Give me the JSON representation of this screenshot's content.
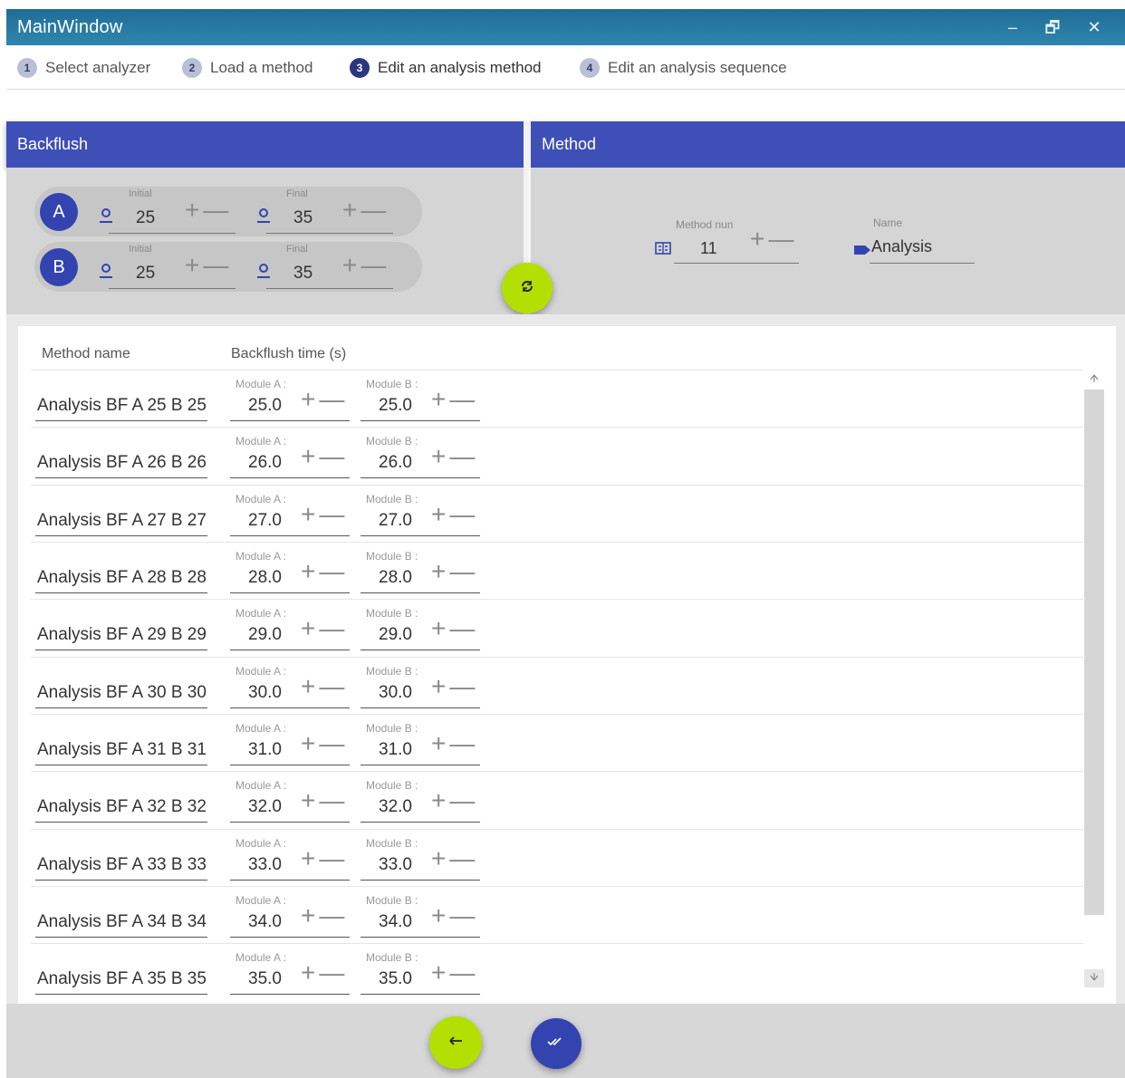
{
  "window": {
    "title": "MainWindow",
    "minimize": "‒",
    "restore": "🗗",
    "close": "✕"
  },
  "steps": [
    {
      "num": "1",
      "label": "Select analyzer"
    },
    {
      "num": "2",
      "label": "Load a method"
    },
    {
      "num": "3",
      "label": "Edit an analysis method"
    },
    {
      "num": "4",
      "label": "Edit an analysis sequence"
    }
  ],
  "backflush": {
    "title": "Backflush",
    "modules": [
      {
        "name": "A",
        "initial_caption": "Initial",
        "initial": "25",
        "final_caption": "Final",
        "final": "35"
      },
      {
        "name": "B",
        "initial_caption": "Initial",
        "initial": "25",
        "final_caption": "Final",
        "final": "35"
      }
    ]
  },
  "method": {
    "title": "Method",
    "num_caption": "Method nun",
    "num_value": "11",
    "name_caption": "Name",
    "name_value": "Analysis"
  },
  "controls": {
    "plus": "+",
    "minus": "—"
  },
  "table": {
    "col_method": "Method name",
    "col_time": "Backflush time (s)",
    "module_a_caption": "Module A :",
    "module_b_caption": "Module B :",
    "rows": [
      {
        "name": "Analysis BF A 25 B 25",
        "a": "25.0",
        "b": "25.0"
      },
      {
        "name": "Analysis BF A 26 B 26",
        "a": "26.0",
        "b": "26.0"
      },
      {
        "name": "Analysis BF A 27 B 27",
        "a": "27.0",
        "b": "27.0"
      },
      {
        "name": "Analysis BF A 28 B 28",
        "a": "28.0",
        "b": "28.0"
      },
      {
        "name": "Analysis BF A 29 B 29",
        "a": "29.0",
        "b": "29.0"
      },
      {
        "name": "Analysis BF A 30 B 30",
        "a": "30.0",
        "b": "30.0"
      },
      {
        "name": "Analysis BF A 31 B 31",
        "a": "31.0",
        "b": "31.0"
      },
      {
        "name": "Analysis BF A 32 B 32",
        "a": "32.0",
        "b": "32.0"
      },
      {
        "name": "Analysis BF A 33 B 33",
        "a": "33.0",
        "b": "33.0"
      },
      {
        "name": "Analysis BF A 34 B 34",
        "a": "34.0",
        "b": "34.0"
      },
      {
        "name": "Analysis BF A 35 B 35",
        "a": "35.0",
        "b": "35.0"
      }
    ]
  },
  "colors": {
    "header_blue": "#3e4fb8",
    "accent_green": "#b3e000",
    "title_bar": "#2a7ca3"
  },
  "icons": {
    "refresh": "refresh-icon",
    "back": "arrow-left-icon",
    "confirm": "double-check-icon",
    "initial_final": "person-icon",
    "method_number": "numeric-icon",
    "name": "label-tag-icon"
  }
}
